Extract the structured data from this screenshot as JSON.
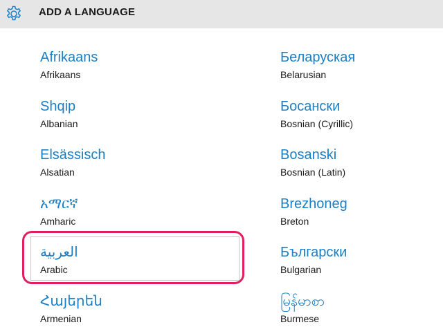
{
  "header": {
    "title": "ADD A LANGUAGE",
    "icon": "gear-icon"
  },
  "languages_left": [
    {
      "native": "Afrikaans",
      "english": "Afrikaans"
    },
    {
      "native": "Shqip",
      "english": "Albanian"
    },
    {
      "native": "Elsässisch",
      "english": "Alsatian"
    },
    {
      "native": "አማርኛ",
      "english": "Amharic"
    },
    {
      "native": "العربية",
      "english": "Arabic"
    },
    {
      "native": "Հայերեն",
      "english": "Armenian"
    }
  ],
  "languages_right": [
    {
      "native": "Беларуская",
      "english": "Belarusian"
    },
    {
      "native": "Босански",
      "english": "Bosnian (Cyrillic)"
    },
    {
      "native": "Bosanski",
      "english": "Bosnian (Latin)"
    },
    {
      "native": "Brezhoneg",
      "english": "Breton"
    },
    {
      "native": "Български",
      "english": "Bulgarian"
    },
    {
      "native": "မြန်မာစာ",
      "english": "Burmese"
    }
  ],
  "selected": "Arabic",
  "colors": {
    "accent": "#1a7fc4",
    "highlight": "#e0205e",
    "header_bg": "#e6e6e6"
  }
}
